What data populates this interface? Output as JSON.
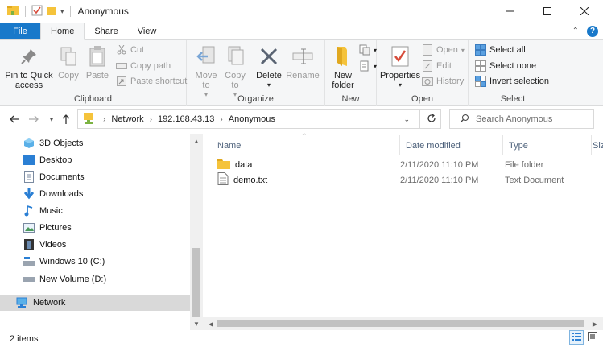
{
  "window": {
    "title": "Anonymous",
    "controls": [
      "minimize",
      "maximize",
      "close"
    ]
  },
  "tabs": {
    "file": "File",
    "home": "Home",
    "share": "Share",
    "view": "View"
  },
  "ribbon": {
    "clipboard": {
      "label": "Clipboard",
      "pin": "Pin to Quick access",
      "copy": "Copy",
      "paste": "Paste",
      "cut": "Cut",
      "copy_path": "Copy path",
      "paste_shortcut": "Paste shortcut"
    },
    "organize": {
      "label": "Organize",
      "move_to": "Move to",
      "copy_to": "Copy to",
      "delete": "Delete",
      "rename": "Rename"
    },
    "new": {
      "label": "New",
      "new_folder": "New folder"
    },
    "open": {
      "label": "Open",
      "properties": "Properties",
      "open": "Open",
      "edit": "Edit",
      "history": "History"
    },
    "select": {
      "label": "Select",
      "select_all": "Select all",
      "select_none": "Select none",
      "invert_selection": "Invert selection"
    }
  },
  "address": {
    "crumbs": [
      "Network",
      "192.168.43.13",
      "Anonymous"
    ]
  },
  "search": {
    "placeholder": "Search Anonymous"
  },
  "nav": {
    "items": [
      {
        "label": "3D Objects",
        "icon": "3d-objects-icon"
      },
      {
        "label": "Desktop",
        "icon": "desktop-icon"
      },
      {
        "label": "Documents",
        "icon": "documents-icon"
      },
      {
        "label": "Downloads",
        "icon": "downloads-icon"
      },
      {
        "label": "Music",
        "icon": "music-icon"
      },
      {
        "label": "Pictures",
        "icon": "pictures-icon"
      },
      {
        "label": "Videos",
        "icon": "videos-icon"
      },
      {
        "label": "Windows 10 (C:)",
        "icon": "drive-c-icon"
      },
      {
        "label": "New Volume (D:)",
        "icon": "drive-d-icon"
      },
      {
        "label": "Network",
        "icon": "network-icon"
      }
    ]
  },
  "columns": {
    "name": "Name",
    "date": "Date modified",
    "type": "Type",
    "size": "Siz"
  },
  "files": [
    {
      "name": "data",
      "date": "2/11/2020 11:10 PM",
      "type": "File folder",
      "icon": "folder-icon"
    },
    {
      "name": "demo.txt",
      "date": "2/11/2020 11:10 PM",
      "type": "Text Document",
      "icon": "text-file-icon"
    }
  ],
  "status": {
    "items": "2 items"
  },
  "colors": {
    "accent": "#1979ca",
    "folder": "#f5c33b",
    "ribbon_bg": "#f5f6f7"
  }
}
